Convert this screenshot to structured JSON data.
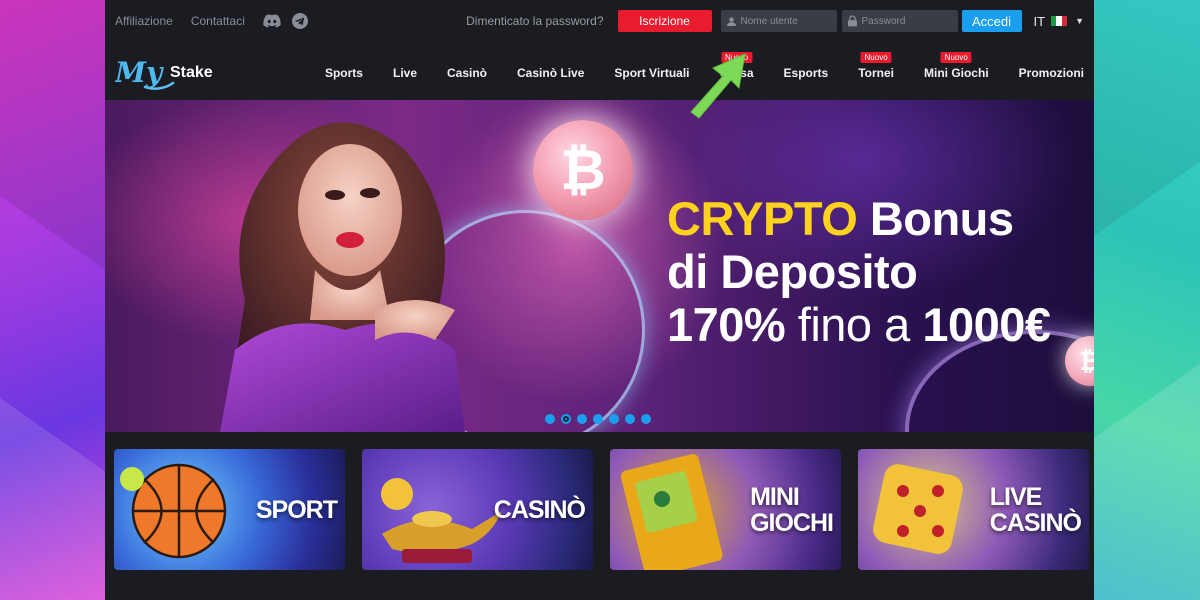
{
  "topbar": {
    "affiliate": "Affiliazione",
    "contact": "Contattaci",
    "forgot": "Dimenticato la password?",
    "register": "Iscrizione",
    "username_placeholder": "Nome utente",
    "password_placeholder": "Password",
    "login": "Accedi",
    "lang": "IT"
  },
  "logo": {
    "my": "My",
    "stake": "Stake"
  },
  "nav": {
    "items": [
      {
        "label": "Sports",
        "badge": ""
      },
      {
        "label": "Live",
        "badge": ""
      },
      {
        "label": "Casinò",
        "badge": ""
      },
      {
        "label": "Casinò Live",
        "badge": ""
      },
      {
        "label": "Sport Virtuali",
        "badge": ""
      },
      {
        "label": "Corsa",
        "badge": "Nuovo"
      },
      {
        "label": "Esports",
        "badge": ""
      },
      {
        "label": "Tornei",
        "badge": "Nuovo"
      },
      {
        "label": "Mini Giochi",
        "badge": "Nuovo"
      },
      {
        "label": "Promozioni",
        "badge": ""
      }
    ]
  },
  "hero": {
    "line1_highlight": "CRYPTO",
    "line1_rest": " Bonus",
    "line2": "di Deposito",
    "line3_bold1": "170%",
    "line3_light": " fino a ",
    "line3_bold2": "1000€",
    "coin_symbol": "₿",
    "slides": 7,
    "active_slide": 2
  },
  "categories": [
    {
      "line1": "SPORT",
      "line2": ""
    },
    {
      "line1": "CASINÒ",
      "line2": ""
    },
    {
      "line1": "MINI",
      "line2": "GIOCHI"
    },
    {
      "line1": "LIVE",
      "line2": "CASINÒ"
    }
  ],
  "colors": {
    "accent_red": "#e81c2e",
    "accent_blue": "#1a9ff0",
    "highlight_yellow": "#ffd21e",
    "arrow_green": "#7dd957"
  }
}
